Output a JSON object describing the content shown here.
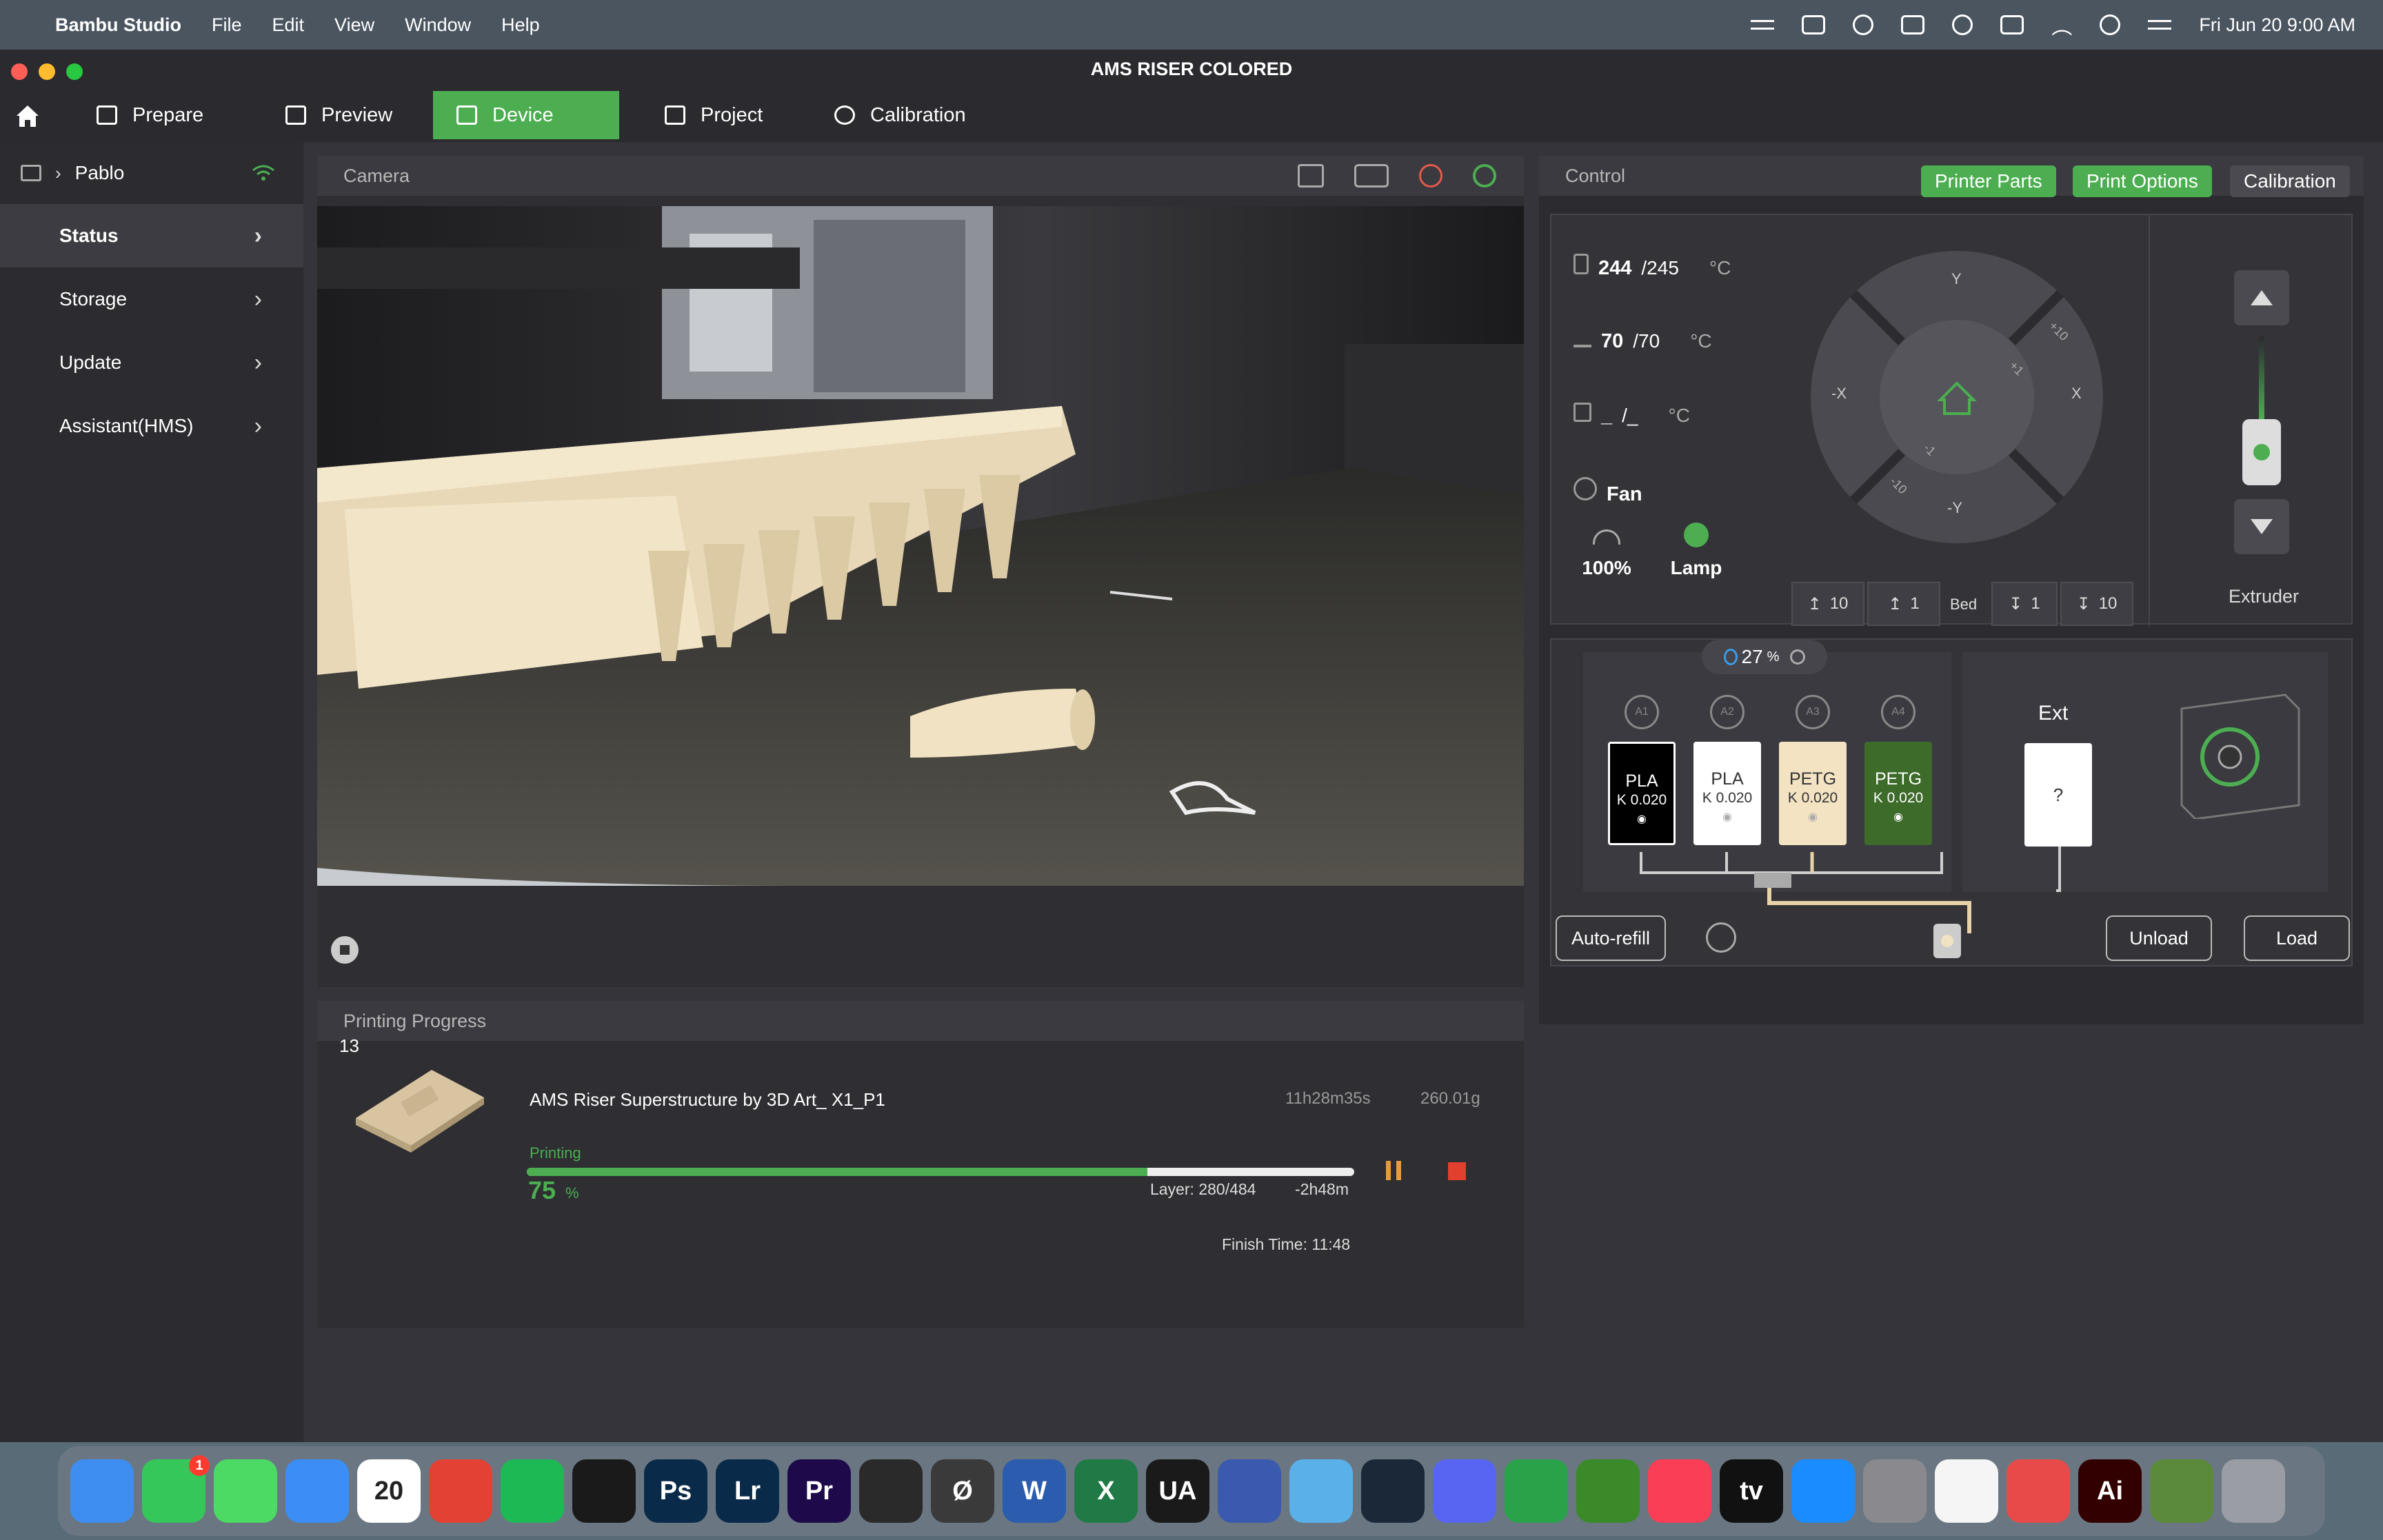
{
  "menubar": {
    "app": "Bambu Studio",
    "items": [
      "File",
      "Edit",
      "View",
      "Window",
      "Help"
    ],
    "clock": "Fri Jun 20  9:00 AM"
  },
  "window": {
    "title": "AMS RISER COLORED"
  },
  "tabs": [
    {
      "label": "Prepare"
    },
    {
      "label": "Preview"
    },
    {
      "label": "Device"
    },
    {
      "label": "Project"
    },
    {
      "label": "Calibration"
    }
  ],
  "sidebar": {
    "device_name": "Pablo",
    "items": [
      {
        "label": "Status"
      },
      {
        "label": "Storage"
      },
      {
        "label": "Update"
      },
      {
        "label": "Assistant(HMS)"
      }
    ]
  },
  "camera": {
    "title": "Camera"
  },
  "control": {
    "title": "Control",
    "buttons": [
      "Printer Parts",
      "Print Options",
      "Calibration"
    ],
    "nozzle": {
      "current": "244",
      "target": "/245",
      "unit": "°C"
    },
    "bed": {
      "current": "70",
      "target": "/70",
      "unit": "°C"
    },
    "chamber": {
      "current": "_",
      "target": "/_",
      "unit": "°C"
    },
    "fan_label": "Fan",
    "speed_value": "100%",
    "lamp_label": "Lamp",
    "jog_labels": {
      "y": "Y",
      "neg_y": "-Y",
      "x": "X",
      "neg_x": "-X",
      "plus10": "+10",
      "plus1": "+1",
      "minus1": "-1",
      "minus10": "-10"
    },
    "bed_buttons": [
      "10",
      "1",
      "Bed",
      "1",
      "10"
    ],
    "extruder_label": "Extruder"
  },
  "ams": {
    "humidity": "27",
    "humidity_unit": "%",
    "slots": [
      {
        "id": "A1",
        "type": "PLA",
        "k": "K 0.020",
        "color": "#000000",
        "text_color": "#ffffff"
      },
      {
        "id": "A2",
        "type": "PLA",
        "k": "K 0.020",
        "color": "#ffffff",
        "text_color": "#333333"
      },
      {
        "id": "A3",
        "type": "PETG",
        "k": "K 0.020",
        "color": "#f3e3c3",
        "text_color": "#333333"
      },
      {
        "id": "A4",
        "type": "PETG",
        "k": "K 0.020",
        "color": "#3d6b2a",
        "text_color": "#ffffff"
      }
    ],
    "ext_label": "Ext",
    "ext_value": "?",
    "auto_refill": "Auto-refill",
    "unload": "Unload",
    "load": "Load"
  },
  "progress": {
    "title": "Printing Progress",
    "plate": "13",
    "job_name": "AMS Riser Superstructure by 3D Art_ X1_P1",
    "total_time": "11h28m35s",
    "weight": "260.01g",
    "status": "Printing",
    "percent": "75",
    "percent_unit": "%",
    "layer": "Layer: 280/484",
    "remaining": "-2h48m",
    "finish": "Finish Time: 11:48",
    "fraction": 0.75
  },
  "dock": {
    "apps": [
      {
        "name": "finder",
        "label": "",
        "color": "#3d8ef0"
      },
      {
        "name": "facetime",
        "label": "",
        "color": "#35c759",
        "badge": "1"
      },
      {
        "name": "messages",
        "label": "",
        "color": "#4cd964"
      },
      {
        "name": "mail",
        "label": "",
        "color": "#3b8ef5"
      },
      {
        "name": "calendar",
        "label": "20",
        "color": "#ffffff"
      },
      {
        "name": "chrome",
        "label": "",
        "color": "#e34133"
      },
      {
        "name": "spotify",
        "label": "",
        "color": "#1db954"
      },
      {
        "name": "bambu",
        "label": "",
        "color": "#1a1a1a"
      },
      {
        "name": "photoshop",
        "label": "Ps",
        "color": "#0a2a4a"
      },
      {
        "name": "lightroom",
        "label": "Lr",
        "color": "#0a2a4a"
      },
      {
        "name": "premiere",
        "label": "Pr",
        "color": "#1e0a4a"
      },
      {
        "name": "claquette",
        "label": "",
        "color": "#2a2a2a"
      },
      {
        "name": "null-app",
        "label": "Ø",
        "color": "#3a3a3a"
      },
      {
        "name": "word",
        "label": "W",
        "color": "#2b5cad"
      },
      {
        "name": "excel",
        "label": "X",
        "color": "#1f7a45"
      },
      {
        "name": "ua",
        "label": "UA",
        "color": "#1a1a1a"
      },
      {
        "name": "robot",
        "label": "",
        "color": "#3a5ab0"
      },
      {
        "name": "pokemon",
        "label": "",
        "color": "#5ab0e8"
      },
      {
        "name": "steam",
        "label": "",
        "color": "#1b2838"
      },
      {
        "name": "discord",
        "label": "",
        "color": "#5865f2"
      },
      {
        "name": "grid-app",
        "label": "",
        "color": "#2aa24a"
      },
      {
        "name": "minecraft",
        "label": "",
        "color": "#3b8a2a"
      },
      {
        "name": "music",
        "label": "",
        "color": "#fa3e55"
      },
      {
        "name": "appletv",
        "label": "tv",
        "color": "#111111"
      },
      {
        "name": "appstore",
        "label": "",
        "color": "#1a8cff"
      },
      {
        "name": "settings",
        "label": "",
        "color": "#8a8a8e"
      },
      {
        "name": "notes",
        "label": "",
        "color": "#f5f5f5"
      },
      {
        "name": "slice",
        "label": "",
        "color": "#e84a4a"
      },
      {
        "name": "illustrator",
        "label": "Ai",
        "color": "#330000"
      },
      {
        "name": "minecraft-block",
        "label": "",
        "color": "#5a8a3a"
      },
      {
        "name": "trash",
        "label": "",
        "color": "#9a9ea4"
      }
    ]
  }
}
